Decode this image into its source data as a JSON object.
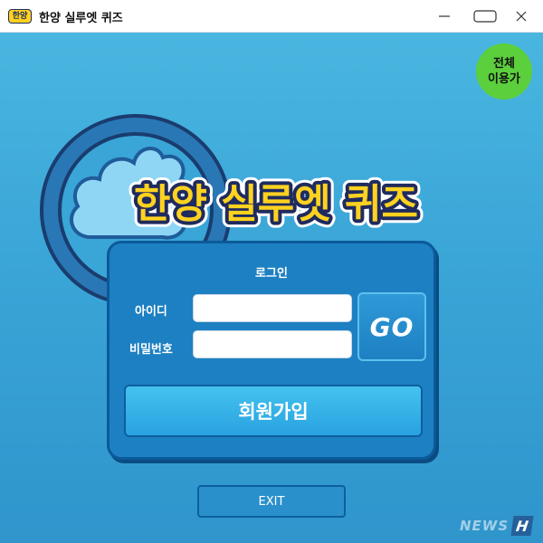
{
  "window": {
    "app_icon_text": "한양",
    "title": "한양 실루엣 퀴즈",
    "minimize_icon": "minimize-icon",
    "maximize_icon": "maximize-icon",
    "close_icon": "close-icon"
  },
  "rating_badge": {
    "line1": "전체",
    "line2": "이용가",
    "color": "#5ccf3c"
  },
  "logo": {
    "text": "한양 실루엣 퀴즈",
    "fill_color": "#ffd21f",
    "stroke_color": "#1f2b5e"
  },
  "login": {
    "title": "로그인",
    "id_label": "아이디",
    "id_value": "",
    "password_label": "비밀번호",
    "password_value": "",
    "go_label": "GO",
    "signup_label": "회원가입"
  },
  "exit_label": "EXIT",
  "watermark": {
    "text": "NEWS",
    "mark": "H"
  },
  "colors": {
    "background": "#3aa5d7",
    "panel": "#1d80c2",
    "panel_border": "#0b5a99"
  }
}
